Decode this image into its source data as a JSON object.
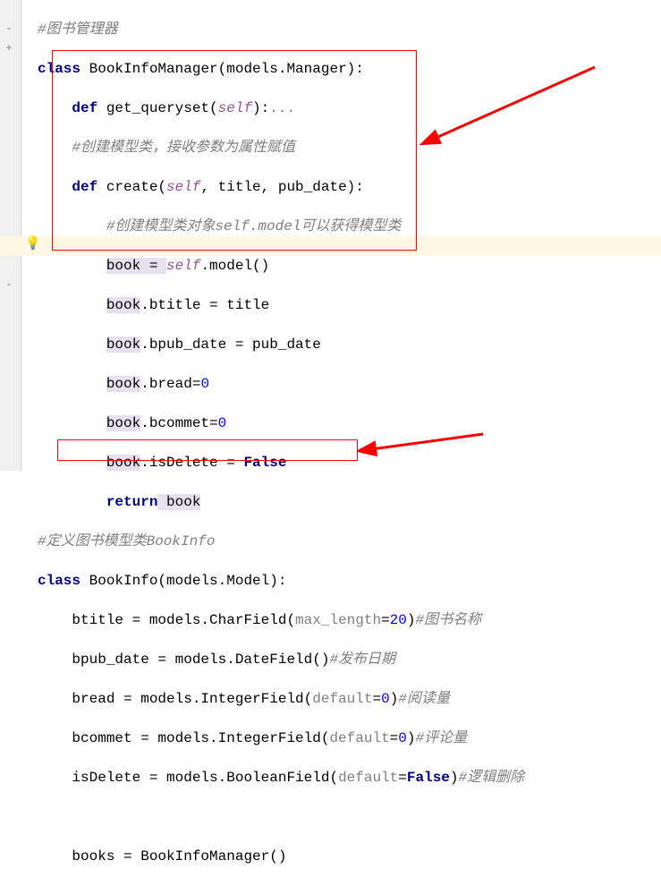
{
  "lines": {
    "c1": "#图书管理器",
    "l2_kw": "class",
    "l2_name": " BookInfoManager(models.Manager):",
    "l3_kw": "def",
    "l3_name": " get_queryset(",
    "l3_self": "self",
    "l3_rest": "):",
    "l3_fold": "...",
    "c4": "#创建模型类，接收参数为属性赋值",
    "l5_kw": "def",
    "l5_name": " create(",
    "l5_self": "self",
    "l5_p1": ", title, pub_date",
    "l5_rest": "):",
    "c6": "#创建模型类对象self.model可以获得模型类",
    "l7a": "book = ",
    "l7_self": "self",
    "l7b": ".model()",
    "l8a": "book.btitle = title",
    "l9a": "book.bpub_date = pub_date",
    "l10a": "book.bread=",
    "l10n": "0",
    "l11a": "book.bcommet=",
    "l11n": "0",
    "l12a": "book.isDelete = ",
    "l12b": "False",
    "l13_kw": "return",
    "l13_rest": " book",
    "c14": "#定义图书模型类BookInfo",
    "l15_kw": "class",
    "l15_name": " BookInfo(models.Model):",
    "l16a": "btitle = models.CharField(",
    "l16_p": "max_length",
    "l16b": "=",
    "l16n": "20",
    "l16c": ")",
    "c16": "#图书名称",
    "l17a": "bpub_date = models.DateField()",
    "c17": "#发布日期",
    "l18a": "bread = models.IntegerField(",
    "l18_p": "default",
    "l18b": "=",
    "l18n": "0",
    "l18c": ")",
    "c18": "#阅读量",
    "l19a": "bcommet = models.IntegerField(",
    "l19_p": "default",
    "l19b": "=",
    "l19n": "0",
    "l19c": ")",
    "c19": "#评论量",
    "l20a": "isDelete = models.BooleanField(",
    "l20_p": "default",
    "l20b": "=",
    "l20v": "False",
    "l20c": ")",
    "c20": "#逻辑删除",
    "l22a": "books = BookInfoManager()"
  },
  "gutter": {
    "fold1": "-",
    "fold2": "+",
    "fold3": "-",
    "bulb": "💡"
  }
}
